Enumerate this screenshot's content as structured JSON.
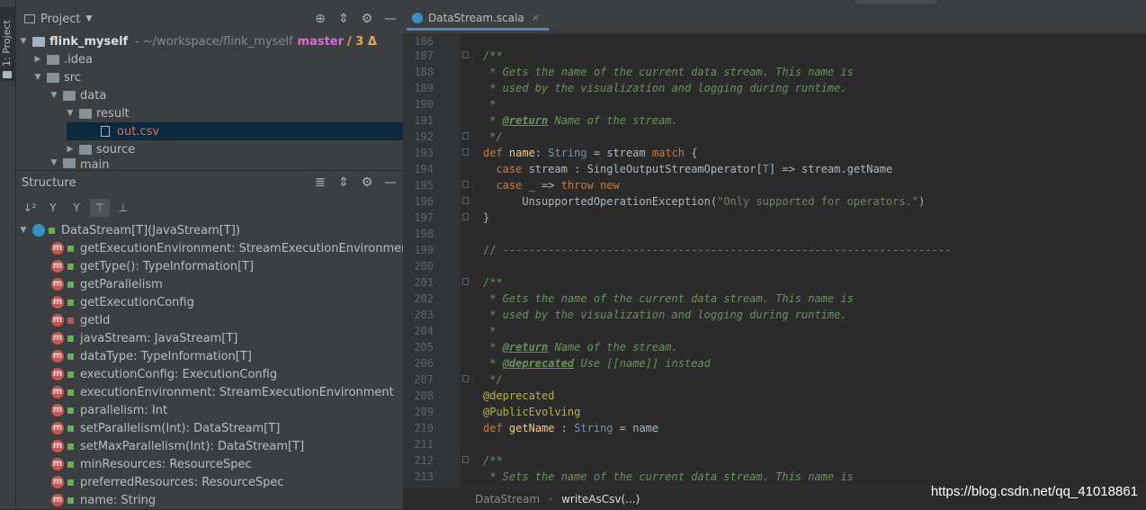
{
  "sidebar_stripe": {
    "label": "1: Project"
  },
  "project_panel": {
    "title": "Project",
    "tree": [
      {
        "name": "flink_myself",
        "path": "~/workspace/flink_myself",
        "branch": "master",
        "changes": "/ 3 Δ"
      },
      {
        "name": ".idea"
      },
      {
        "name": "src"
      },
      {
        "name": "data"
      },
      {
        "name": "result"
      },
      {
        "name": "out.csv"
      },
      {
        "name": "source"
      },
      {
        "name": "main"
      }
    ]
  },
  "structure_panel": {
    "title": "Structure",
    "root": "DataStream[T](JavaStream[T])",
    "members": [
      {
        "label": "getExecutionEnvironment: StreamExecutionEnvironment",
        "badge": "m",
        "access": "public"
      },
      {
        "label": "getType(): TypeInformation[T]",
        "badge": "m",
        "access": "public"
      },
      {
        "label": "getParallelism",
        "badge": "m",
        "access": "public"
      },
      {
        "label": "getExecutionConfig",
        "badge": "m",
        "access": "public"
      },
      {
        "label": "getId",
        "badge": "m",
        "access": "private"
      },
      {
        "label": "javaStream: JavaStream[T]",
        "badge": "m",
        "access": "public"
      },
      {
        "label": "dataType: TypeInformation[T]",
        "badge": "m",
        "access": "public"
      },
      {
        "label": "executionConfig: ExecutionConfig",
        "badge": "m",
        "access": "public"
      },
      {
        "label": "executionEnvironment: StreamExecutionEnvironment",
        "badge": "m",
        "access": "public"
      },
      {
        "label": "parallelism: Int",
        "badge": "m",
        "access": "public"
      },
      {
        "label": "setParallelism(Int): DataStream[T]",
        "badge": "m",
        "access": "public"
      },
      {
        "label": "setMaxParallelism(Int): DataStream[T]",
        "badge": "m",
        "access": "public"
      },
      {
        "label": "minResources: ResourceSpec",
        "badge": "m",
        "access": "public"
      },
      {
        "label": "preferredResources: ResourceSpec",
        "badge": "m",
        "access": "public"
      },
      {
        "label": "name: String",
        "badge": "m",
        "access": "public"
      }
    ]
  },
  "editor": {
    "tab": {
      "label": "DataStream.scala",
      "close": "×"
    },
    "lines": [
      {
        "n": "186"
      },
      {
        "n": "187"
      },
      {
        "n": "188"
      },
      {
        "n": "189"
      },
      {
        "n": "190"
      },
      {
        "n": "191"
      },
      {
        "n": "192"
      },
      {
        "n": "193"
      },
      {
        "n": "194"
      },
      {
        "n": "195"
      },
      {
        "n": "196"
      },
      {
        "n": "197"
      },
      {
        "n": "198"
      },
      {
        "n": "199"
      },
      {
        "n": "200"
      },
      {
        "n": "201"
      },
      {
        "n": "202"
      },
      {
        "n": "203"
      },
      {
        "n": "204"
      },
      {
        "n": "205"
      },
      {
        "n": "206"
      },
      {
        "n": "207"
      },
      {
        "n": "208"
      },
      {
        "n": "209"
      },
      {
        "n": "210"
      },
      {
        "n": "211"
      },
      {
        "n": "212"
      },
      {
        "n": "213"
      }
    ]
  },
  "breadcrumb": {
    "item1": "DataStream",
    "separator": "›",
    "item2": "writeAsCsv(...)"
  },
  "watermark": "https://blog.csdn.net/qq_41018861"
}
